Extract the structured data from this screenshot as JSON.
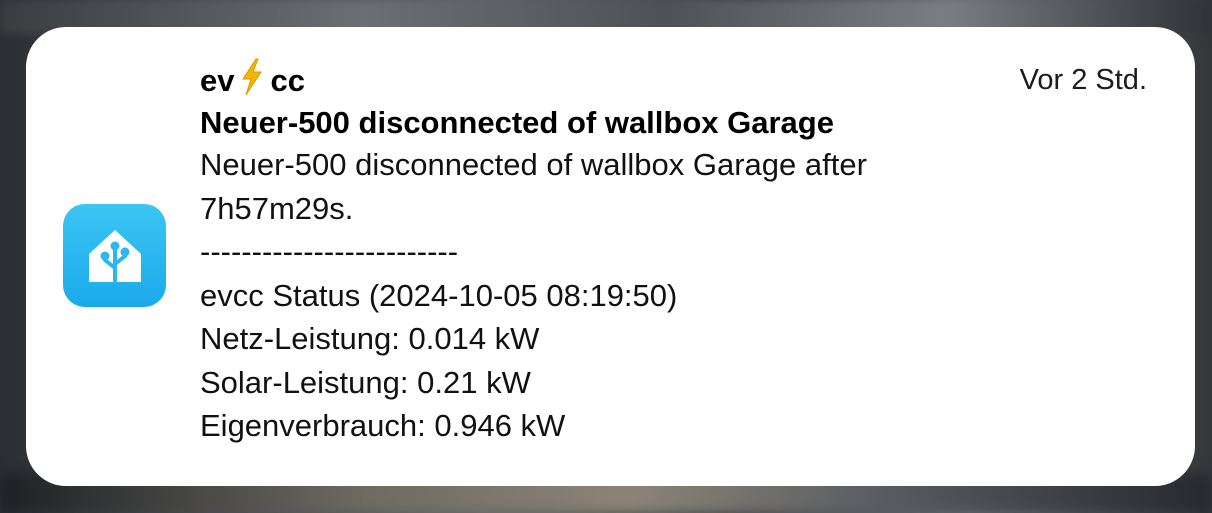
{
  "notification": {
    "app_name_prefix": "ev",
    "app_name_suffix": "cc",
    "app_icon": "home-assistant-icon",
    "bolt_icon": "lightning-bolt-icon",
    "timestamp": "Vor 2 Std.",
    "title": "Neuer-500 disconnected of wallbox Garage",
    "body_lines": [
      "Neuer-500 disconnected of wallbox Garage after",
      "7h57m29s.",
      "-------------------------",
      "evcc Status (2024-10-05 08:19:50)",
      "Netz-Leistung: 0.014 kW",
      "Solar-Leistung: 0.21 kW",
      "Eigenverbrauch: 0.946 kW"
    ],
    "icon_color": "#1aa9ec",
    "bolt_color": "#f5b400"
  }
}
